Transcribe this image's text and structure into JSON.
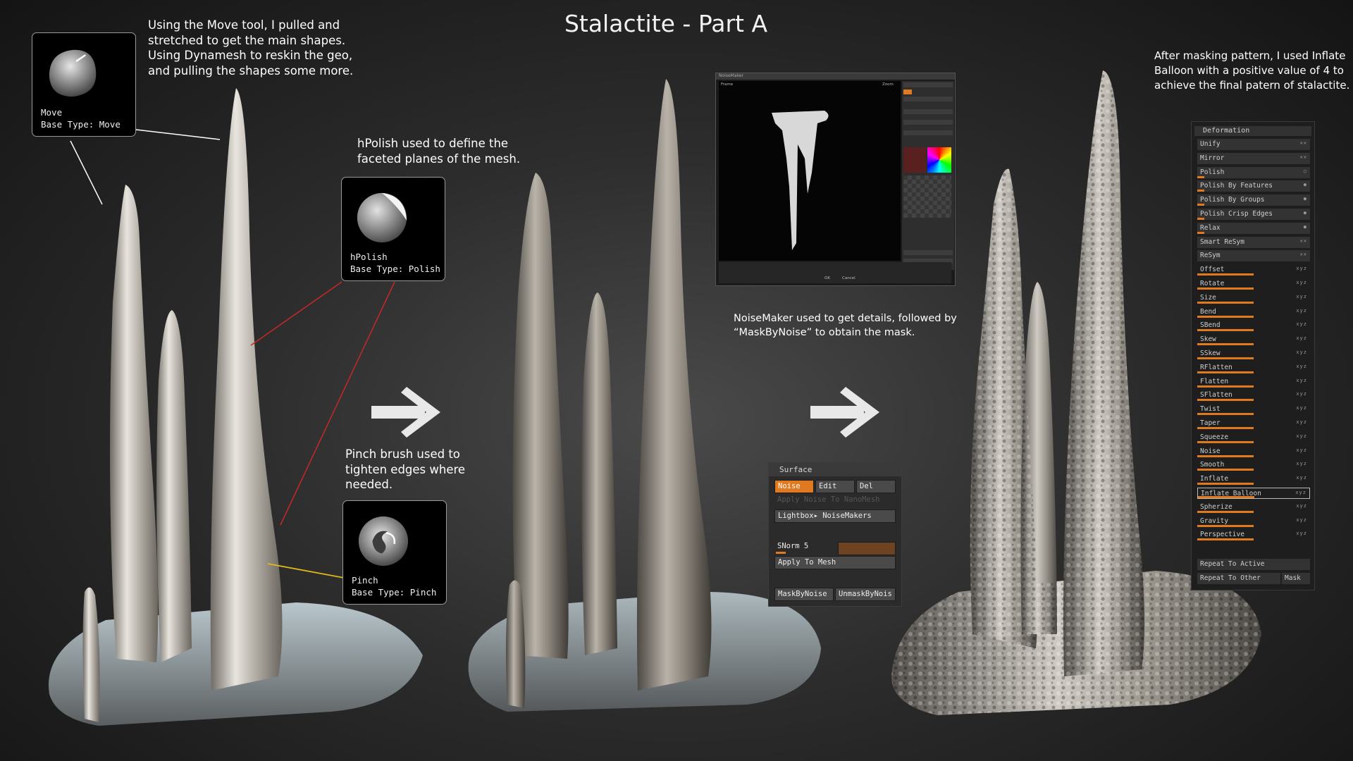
{
  "title": "Stalactite - Part A",
  "notes": {
    "move": "Using the Move tool, I pulled and\nstretched to get the main shapes.\nUsing Dynamesh to reskin the geo,\nand pulling the shapes some more.",
    "hpolish": "hPolish used to define the\nfaceted planes of the mesh.",
    "pinch": "Pinch brush used to\ntighten edges where\nneeded.",
    "noisemaker": "NoiseMaker used to get details, followed by\n“MaskByNoise” to obtain the mask.",
    "inflate": "After masking pattern, I used Inflate\nBalloon with a positive value of 4 to\nachieve the final patern of stalactite."
  },
  "brushes": {
    "move": {
      "name": "Move",
      "base_type": "Base Type: Move",
      "icon": "move-brush-icon"
    },
    "hpolish": {
      "name": "hPolish",
      "base_type": "Base Type: Polish",
      "icon": "hpolish-brush-icon"
    },
    "pinch": {
      "name": "Pinch",
      "base_type": "Base Type: Pinch",
      "icon": "pinch-brush-icon"
    }
  },
  "noisemaker": {
    "window_title": "NoiseMaker",
    "frame_label": "Frame",
    "zoom_label": "Zoom",
    "ok_label": "OK",
    "cancel_label": "Cancel"
  },
  "surface_panel": {
    "header": "Surface",
    "noise": "Noise",
    "edit": "Edit",
    "del": "Del",
    "apply_nanomesh": "Apply Noise To NanoMesh",
    "lightbox": "Lightbox▸ NoiseMakers",
    "snorm": "SNorm 5",
    "snorm_value": 5,
    "apply_mesh": "Apply To Mesh",
    "mask_by_noise": "MaskByNoise",
    "unmask_by_noise": "UnmaskByNois"
  },
  "deformation_panel": {
    "header": "Deformation",
    "rows": [
      {
        "label": "Unify",
        "axes": "✕✕"
      },
      {
        "label": "Mirror",
        "axes": "✕✕"
      },
      {
        "label": "Polish",
        "axes": "○"
      },
      {
        "label": "Polish By Features",
        "axes": "●"
      },
      {
        "label": "Polish By Groups",
        "axes": "●"
      },
      {
        "label": "Polish Crisp Edges",
        "axes": "●"
      },
      {
        "label": "Relax",
        "axes": "●"
      },
      {
        "label": "Smart ReSym",
        "axes": "✕✕"
      },
      {
        "label": "ReSym",
        "axes": "✕✕"
      },
      {
        "label": "Offset",
        "axes": "xyz"
      },
      {
        "label": "Rotate",
        "axes": "xyz"
      },
      {
        "label": "Size",
        "axes": "xyz"
      },
      {
        "label": "Bend",
        "axes": "xyz"
      },
      {
        "label": "SBend",
        "axes": "xyz"
      },
      {
        "label": "Skew",
        "axes": "xyz"
      },
      {
        "label": "SSkew",
        "axes": "xyz"
      },
      {
        "label": "RFlatten",
        "axes": "xyz"
      },
      {
        "label": "Flatten",
        "axes": "xyz"
      },
      {
        "label": "SFlatten",
        "axes": "xyz"
      },
      {
        "label": "Twist",
        "axes": "xyz"
      },
      {
        "label": "Taper",
        "axes": "xyz"
      },
      {
        "label": "Squeeze",
        "axes": "xyz"
      },
      {
        "label": "Noise",
        "axes": "xyz"
      },
      {
        "label": "Smooth",
        "axes": "xyz"
      },
      {
        "label": "Inflate",
        "axes": "xyz"
      },
      {
        "label": "Inflate Balloon",
        "axes": "xyz"
      },
      {
        "label": "Spherize",
        "axes": "xyz"
      },
      {
        "label": "Gravity",
        "axes": "xyz"
      },
      {
        "label": "Perspective",
        "axes": "xyz"
      }
    ],
    "repeat_active": "Repeat To Active",
    "repeat_other": "Repeat To Other",
    "mask": "Mask"
  },
  "colors": {
    "accent": "#e0791f",
    "leader_white": "#ffffff",
    "leader_red": "#c62828",
    "leader_yellow": "#e0b81c"
  }
}
